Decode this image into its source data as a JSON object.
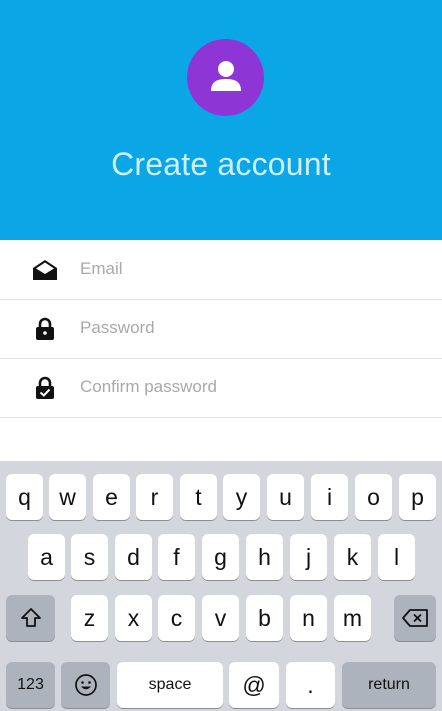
{
  "header": {
    "title": "Create account",
    "avatar_icon": "user-icon",
    "bg_color": "#0aa6e6",
    "avatar_color": "#8e35d6"
  },
  "form": {
    "email": {
      "placeholder": "Email",
      "value": "",
      "icon": "envelope-open-icon"
    },
    "password": {
      "placeholder": "Password",
      "value": "",
      "icon": "lock-icon"
    },
    "confirm": {
      "placeholder": "Confirm password",
      "value": "",
      "icon": "lock-check-icon"
    }
  },
  "keyboard": {
    "row1": [
      "q",
      "w",
      "e",
      "r",
      "t",
      "y",
      "u",
      "i",
      "o",
      "p"
    ],
    "row2": [
      "a",
      "s",
      "d",
      "f",
      "g",
      "h",
      "j",
      "k",
      "l"
    ],
    "row3": [
      "z",
      "x",
      "c",
      "v",
      "b",
      "n",
      "m"
    ],
    "numbers": "123",
    "space": "space",
    "at": "@",
    "dot": ".",
    "return": "return"
  }
}
